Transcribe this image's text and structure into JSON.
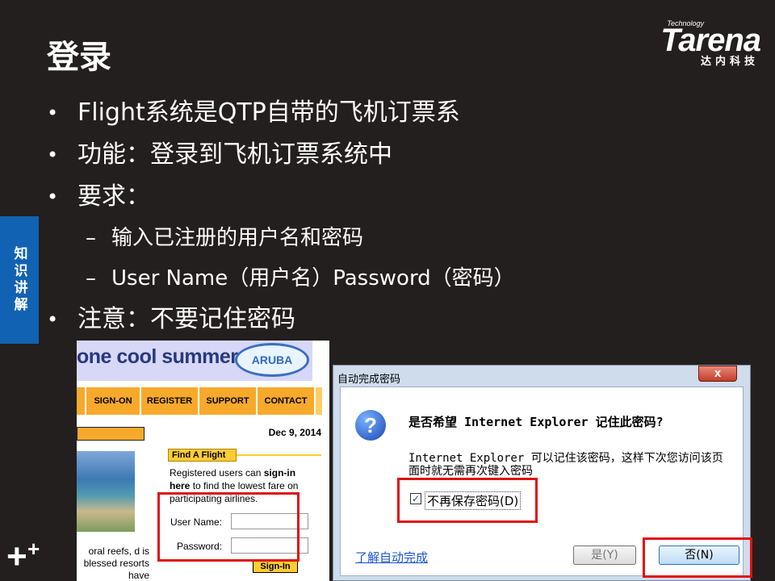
{
  "slide": {
    "title": "登录",
    "side_tab": "知识讲解"
  },
  "logo": {
    "tech": "Technology",
    "brand": "Tarena",
    "cn": "达内科技"
  },
  "bullets": [
    "Flight系统是QTP自带的飞机订票系",
    "功能：登录到飞机订票系统中",
    "要求：",
    "输入已注册的用户名和密码",
    "User Name（用户名）Password（密码）",
    "注意：不要记住密码"
  ],
  "mercury": {
    "banner_text": "one cool summer",
    "aruba_logo": "ARUBA",
    "nav": [
      "SIGN-ON",
      "REGISTER",
      "SUPPORT",
      "CONTACT"
    ],
    "date": "Dec 9, 2014",
    "find_flight": "Find A Flight",
    "registered_text_1": "Registered users can ",
    "registered_bold_1": "sign-in",
    "registered_bold_2": "here",
    "registered_text_2": " to find the lowest fare on participating airlines.",
    "username_label": "User Name:",
    "password_label": "Password:",
    "blurb": "oral reefs, d is blessed resorts have",
    "signin_button": "Sign-In"
  },
  "ie_dialog": {
    "title": "自动完成密码",
    "close": "x",
    "question": "是否希望 Internet Explorer 记住此密码?",
    "description": "Internet Explorer 可以记住该密码，这样下次您访问该页面时就无需再次键入密码",
    "checkbox_label": "不再保存密码(D)",
    "checkbox_checked": true,
    "link": "了解自动完成",
    "yes_button": "是(Y)",
    "no_button": "否(N)"
  }
}
